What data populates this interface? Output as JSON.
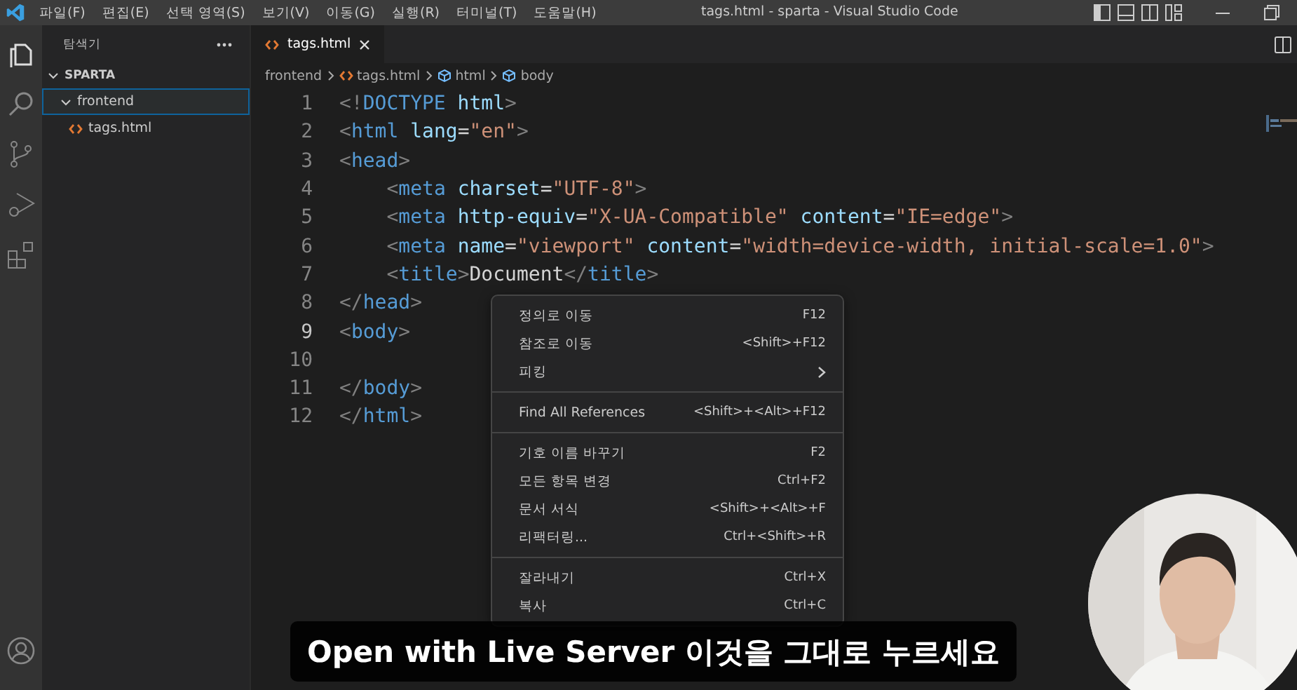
{
  "window": {
    "title": "tags.html - sparta - Visual Studio Code"
  },
  "menu": [
    "파일(F)",
    "편집(E)",
    "선택 영역(S)",
    "보기(V)",
    "이동(G)",
    "실행(R)",
    "터미널(T)",
    "도움말(H)"
  ],
  "sidebar": {
    "title": "탐색기",
    "section": "SPARTA",
    "section_expanded": true,
    "tree": [
      {
        "name": "frontend",
        "kind": "folder",
        "expanded": true,
        "selected": true,
        "children": [
          {
            "name": "tags.html",
            "kind": "file",
            "selected": false
          }
        ]
      }
    ]
  },
  "tabs": [
    {
      "label": "tags.html",
      "selected": true
    }
  ],
  "breadcrumbs": [
    {
      "label": "frontend",
      "kind": "folder"
    },
    {
      "label": "tags.html",
      "kind": "file"
    },
    {
      "label": "html",
      "kind": "element"
    },
    {
      "label": "body",
      "kind": "element"
    }
  ],
  "code": [
    {
      "number": "1",
      "current": false,
      "tokens": [
        {
          "kind": "punct",
          "text": "<!"
        },
        {
          "kind": "tag",
          "text": "DOCTYPE "
        },
        {
          "kind": "attr",
          "text": "html"
        },
        {
          "kind": "punct",
          "text": ">"
        }
      ]
    },
    {
      "number": "2",
      "current": false,
      "tokens": [
        {
          "kind": "punct",
          "text": "<"
        },
        {
          "kind": "tag",
          "text": "html "
        },
        {
          "kind": "attr",
          "text": "lang"
        },
        {
          "kind": "plain",
          "text": "="
        },
        {
          "kind": "string",
          "text": "\"en\""
        },
        {
          "kind": "punct",
          "text": ">"
        }
      ]
    },
    {
      "number": "3",
      "current": false,
      "tokens": [
        {
          "kind": "punct",
          "text": "<"
        },
        {
          "kind": "tag",
          "text": "head"
        },
        {
          "kind": "punct",
          "text": ">"
        }
      ]
    },
    {
      "number": "4",
      "current": false,
      "tokens": [
        {
          "kind": "punct",
          "text": "    <"
        },
        {
          "kind": "tag",
          "text": "meta "
        },
        {
          "kind": "attr",
          "text": "charset"
        },
        {
          "kind": "plain",
          "text": "="
        },
        {
          "kind": "string",
          "text": "\"UTF-8\""
        },
        {
          "kind": "punct",
          "text": ">"
        }
      ]
    },
    {
      "number": "5",
      "current": false,
      "tokens": [
        {
          "kind": "punct",
          "text": "    <"
        },
        {
          "kind": "tag",
          "text": "meta "
        },
        {
          "kind": "attr",
          "text": "http-equiv"
        },
        {
          "kind": "plain",
          "text": "="
        },
        {
          "kind": "string",
          "text": "\"X-UA-Compatible\" "
        },
        {
          "kind": "attr",
          "text": "content"
        },
        {
          "kind": "plain",
          "text": "="
        },
        {
          "kind": "string",
          "text": "\"IE=edge\""
        },
        {
          "kind": "punct",
          "text": ">"
        }
      ]
    },
    {
      "number": "6",
      "current": false,
      "tokens": [
        {
          "kind": "punct",
          "text": "    <"
        },
        {
          "kind": "tag",
          "text": "meta "
        },
        {
          "kind": "attr",
          "text": "name"
        },
        {
          "kind": "plain",
          "text": "="
        },
        {
          "kind": "string",
          "text": "\"viewport\" "
        },
        {
          "kind": "attr",
          "text": "content"
        },
        {
          "kind": "plain",
          "text": "="
        },
        {
          "kind": "string",
          "text": "\"width=device-width, initial-scale=1.0\""
        },
        {
          "kind": "punct",
          "text": ">"
        }
      ]
    },
    {
      "number": "7",
      "current": false,
      "tokens": [
        {
          "kind": "punct",
          "text": "    <"
        },
        {
          "kind": "tag",
          "text": "title"
        },
        {
          "kind": "punct",
          "text": ">"
        },
        {
          "kind": "plain",
          "text": "Document"
        },
        {
          "kind": "punct",
          "text": "</"
        },
        {
          "kind": "tag",
          "text": "title"
        },
        {
          "kind": "punct",
          "text": ">"
        }
      ]
    },
    {
      "number": "8",
      "current": false,
      "tokens": [
        {
          "kind": "punct",
          "text": "</"
        },
        {
          "kind": "tag",
          "text": "head"
        },
        {
          "kind": "punct",
          "text": ">"
        }
      ]
    },
    {
      "number": "9",
      "current": true,
      "tokens": [
        {
          "kind": "punct",
          "text": "<"
        },
        {
          "kind": "tag",
          "text": "body"
        },
        {
          "kind": "punct",
          "text": ">"
        }
      ]
    },
    {
      "number": "10",
      "current": false
    },
    {
      "number": "11",
      "current": false,
      "tokens": [
        {
          "kind": "punct",
          "text": "</"
        },
        {
          "kind": "tag",
          "text": "body"
        },
        {
          "kind": "punct",
          "text": ">"
        }
      ]
    },
    {
      "number": "12",
      "current": false,
      "tokens": [
        {
          "kind": "punct",
          "text": "</"
        },
        {
          "kind": "tag",
          "text": "html"
        },
        {
          "kind": "punct",
          "text": ">"
        }
      ]
    }
  ],
  "context_menu": [
    {
      "items": [
        {
          "label": "정의로 이동",
          "shortcut": "F12"
        },
        {
          "label": "참조로 이동",
          "shortcut": "<Shift>+F12"
        },
        {
          "label": "피킹",
          "submenu": true
        }
      ]
    },
    {
      "items": [
        {
          "label": "Find All References",
          "shortcut": "<Shift>+<Alt>+F12"
        }
      ]
    },
    {
      "items": [
        {
          "label": "기호 이름 바꾸기",
          "shortcut": "F2"
        },
        {
          "label": "모든 항목 변경",
          "shortcut": "Ctrl+F2"
        },
        {
          "label": "문서 서식",
          "shortcut": "<Shift>+<Alt>+F"
        },
        {
          "label": "리팩터링...",
          "shortcut": "Ctrl+<Shift>+R"
        }
      ]
    },
    {
      "items": [
        {
          "label": "잘라내기",
          "shortcut": "Ctrl+X"
        },
        {
          "label": "복사",
          "shortcut": "Ctrl+C"
        }
      ]
    }
  ],
  "subtitle": "Open with Live Server 이것을 그대로 누르세요",
  "webcam": {
    "kind": "picture"
  }
}
